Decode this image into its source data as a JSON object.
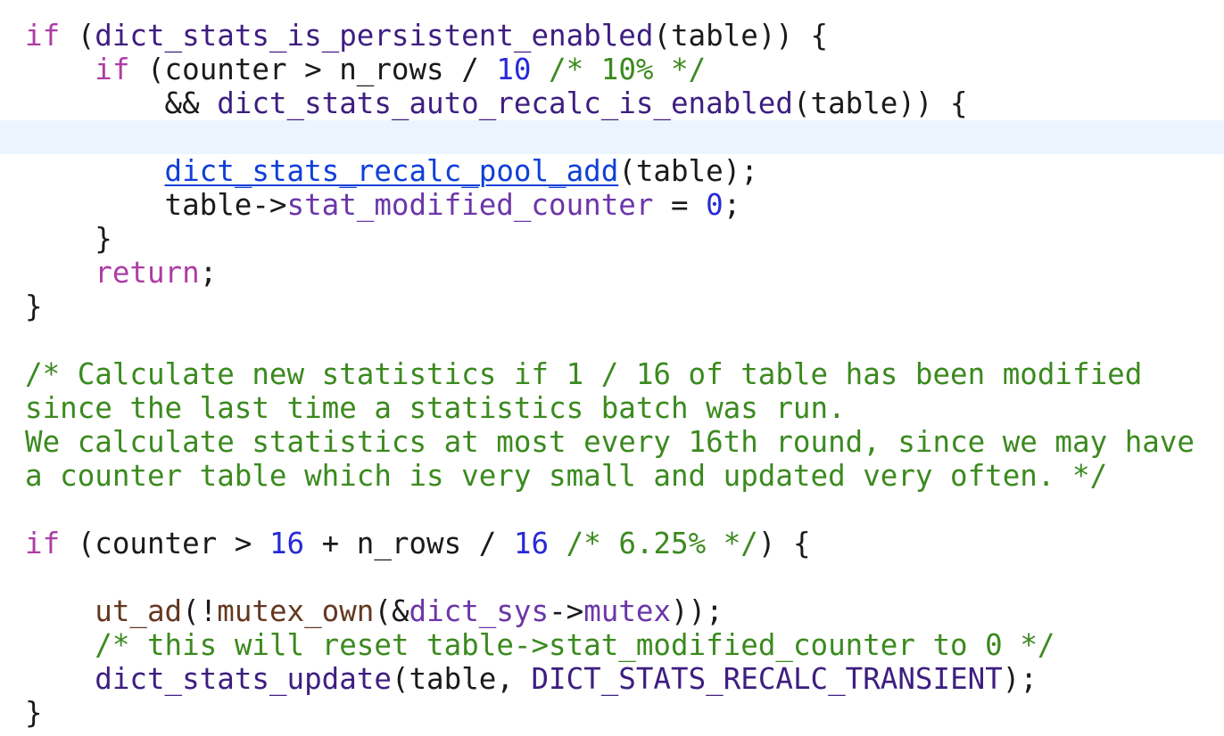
{
  "editor": {
    "lines": [
      [
        {
          "text": "if",
          "type": "keyword"
        },
        {
          "text": " (",
          "type": "plain"
        },
        {
          "text": "dict_stats_is_persistent_enabled",
          "type": "func"
        },
        {
          "text": "(table)) {",
          "type": "plain"
        }
      ],
      [
        {
          "text": "    ",
          "type": "plain"
        },
        {
          "text": "if",
          "type": "keyword"
        },
        {
          "text": " (counter > n_rows / ",
          "type": "plain"
        },
        {
          "text": "10",
          "type": "number"
        },
        {
          "text": " ",
          "type": "plain"
        },
        {
          "text": "/* 10% */",
          "type": "comment"
        }
      ],
      [
        {
          "text": "        && ",
          "type": "plain"
        },
        {
          "text": "dict_stats_auto_recalc_is_enabled",
          "type": "func"
        },
        {
          "text": "(table)) {",
          "type": "plain"
        }
      ],
      [],
      [
        {
          "text": "        ",
          "type": "plain"
        },
        {
          "text": "dict_stats_recalc_pool_add",
          "type": "link"
        },
        {
          "text": "(table);",
          "type": "plain"
        }
      ],
      [
        {
          "text": "        table->",
          "type": "plain"
        },
        {
          "text": "stat_modified_counter",
          "type": "member"
        },
        {
          "text": " = ",
          "type": "plain"
        },
        {
          "text": "0",
          "type": "number"
        },
        {
          "text": ";",
          "type": "plain"
        }
      ],
      [
        {
          "text": "    }",
          "type": "plain"
        }
      ],
      [
        {
          "text": "    ",
          "type": "plain"
        },
        {
          "text": "return",
          "type": "keyword"
        },
        {
          "text": ";",
          "type": "plain"
        }
      ],
      [
        {
          "text": "}",
          "type": "plain"
        }
      ],
      [],
      [
        {
          "text": "/* Calculate new statistics if 1 / 16 of table has been modified",
          "type": "comment"
        }
      ],
      [
        {
          "text": "since the last time a statistics batch was run.",
          "type": "comment"
        }
      ],
      [
        {
          "text": "We calculate statistics at most every 16th round, since we may have",
          "type": "comment"
        }
      ],
      [
        {
          "text": "a counter table which is very small and updated very often. */",
          "type": "comment"
        }
      ],
      [],
      [
        {
          "text": "if",
          "type": "keyword"
        },
        {
          "text": " (counter > ",
          "type": "plain"
        },
        {
          "text": "16",
          "type": "number"
        },
        {
          "text": " + n_rows / ",
          "type": "plain"
        },
        {
          "text": "16",
          "type": "number"
        },
        {
          "text": " ",
          "type": "plain"
        },
        {
          "text": "/* 6.25% */",
          "type": "comment"
        },
        {
          "text": ") {",
          "type": "plain"
        }
      ],
      [],
      [
        {
          "text": "    ",
          "type": "plain"
        },
        {
          "text": "ut_ad",
          "type": "macro"
        },
        {
          "text": "(!",
          "type": "plain"
        },
        {
          "text": "mutex_own",
          "type": "macro"
        },
        {
          "text": "(&",
          "type": "plain"
        },
        {
          "text": "dict_sys",
          "type": "member"
        },
        {
          "text": "->",
          "type": "plain"
        },
        {
          "text": "mutex",
          "type": "member"
        },
        {
          "text": "));",
          "type": "plain"
        }
      ],
      [
        {
          "text": "    ",
          "type": "plain"
        },
        {
          "text": "/* this will reset table->stat_modified_counter to 0 */",
          "type": "comment"
        }
      ],
      [
        {
          "text": "    ",
          "type": "plain"
        },
        {
          "text": "dict_stats_update",
          "type": "func"
        },
        {
          "text": "(table, ",
          "type": "plain"
        },
        {
          "text": "DICT_STATS_RECALC_TRANSIENT",
          "type": "func"
        },
        {
          "text": ");",
          "type": "plain"
        }
      ],
      [
        {
          "text": "}",
          "type": "plain"
        }
      ]
    ],
    "colors": {
      "keyword": "#ad3da4",
      "func": "#3e1e80",
      "member": "#6c36a9",
      "number": "#272ad8",
      "comment": "#3b8a1f",
      "macro": "#643820",
      "link": "#0f3fd6",
      "plain": "#1a1a1a",
      "current_line_highlight": "#ecf5ff",
      "background": "#ffffff"
    }
  }
}
